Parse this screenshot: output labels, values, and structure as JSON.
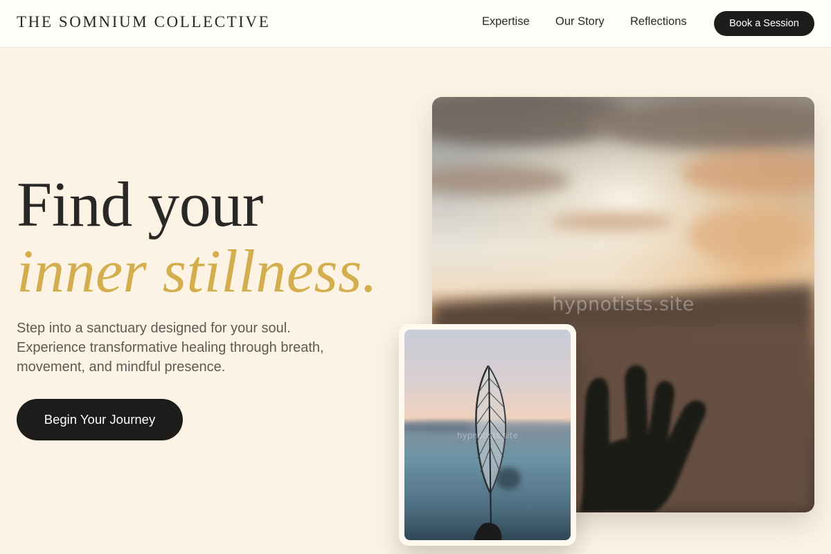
{
  "header": {
    "brand": "THE SOMNIUM COLLECTIVE",
    "nav": [
      "Expertise",
      "Our Story",
      "Reflections"
    ],
    "cta_label": "Book a Session"
  },
  "hero": {
    "title_line1": "Find your",
    "title_line2": "inner stillness.",
    "description": "Step into a sanctuary designed for your soul. Experience transformative healing through breath, movement, and mindful presence.",
    "cta_label": "Begin Your Journey"
  },
  "images": {
    "main_watermark": "hypnotists.site",
    "inset_watermark": "hypnotists.site"
  },
  "colors": {
    "background": "#fdf3e5",
    "accent_gold": "#d3ae4e",
    "button_dark": "#1d1c1b",
    "text_dark": "#2a2826"
  }
}
